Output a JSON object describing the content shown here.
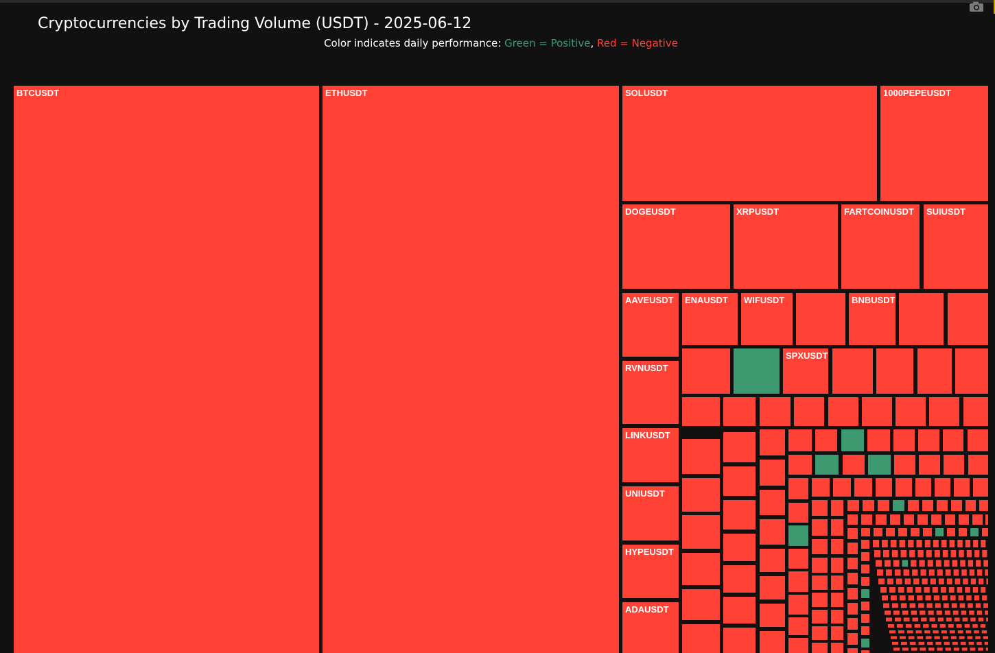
{
  "title": "Cryptocurrencies by Trading Volume (USDT) - 2025-06-12",
  "subtitle": {
    "prefix": "Color indicates daily performance: ",
    "positive_text": "Green = Positive",
    "separator": ", ",
    "negative_text": "Red = Negative"
  },
  "colors": {
    "positive": "#3d9970",
    "negative": "#ff4136",
    "background": "#111111",
    "border": "#111111"
  },
  "icons": {
    "toolbar": "camera-icon"
  },
  "chart_data": {
    "type": "treemap",
    "metric": "Trading Volume (USDT)",
    "date": "2025-06-12",
    "color_encoding": "daily performance: green = positive, red = negative",
    "labeled_tiles": [
      {
        "label": "BTCUSDT",
        "sign": "negative"
      },
      {
        "label": "ETHUSDT",
        "sign": "negative"
      },
      {
        "label": "SOLUSDT",
        "sign": "negative"
      },
      {
        "label": "1000PEPEUSDT",
        "sign": "negative"
      },
      {
        "label": "DOGEUSDT",
        "sign": "negative"
      },
      {
        "label": "XRPUSDT",
        "sign": "negative"
      },
      {
        "label": "FARTCOINUSDT",
        "sign": "negative"
      },
      {
        "label": "SUIUSDT",
        "sign": "negative"
      },
      {
        "label": "AAVEUSDT",
        "sign": "negative"
      },
      {
        "label": "ENAUSDT",
        "sign": "negative"
      },
      {
        "label": "WIFUSDT",
        "sign": "negative"
      },
      {
        "label": "BNBUSDT",
        "sign": "negative"
      },
      {
        "label": "RVNUSDT",
        "sign": "negative"
      },
      {
        "label": "SPXUSDT",
        "sign": "negative"
      },
      {
        "label": "LINKUSDT",
        "sign": "negative"
      },
      {
        "label": "UNIUSDT",
        "sign": "negative"
      },
      {
        "label": "HYPEUSDT",
        "sign": "negative"
      },
      {
        "label": "ADAUSDT",
        "sign": "negative"
      }
    ],
    "unlabeled_tile_signs": {
      "row_enausdt": [
        "negative",
        "negative"
      ],
      "row_spxusdt_before": [
        "negative",
        "positive"
      ],
      "row_spxusdt_after": [
        "negative",
        "negative",
        "negative",
        "negative"
      ],
      "row_a": [
        "negative",
        "negative",
        "negative",
        "negative",
        "negative",
        "negative",
        "negative",
        "negative",
        "negative"
      ],
      "row_b": [
        "negative",
        "negative",
        "positive",
        "negative",
        "negative",
        "negative",
        "negative",
        "negative"
      ],
      "row_c": [
        "negative",
        "positive",
        "negative",
        "positive",
        "negative",
        "negative",
        "negative",
        "negative"
      ],
      "grid_positive_count": 8,
      "grid_note": "remaining small tiles all negative"
    }
  }
}
